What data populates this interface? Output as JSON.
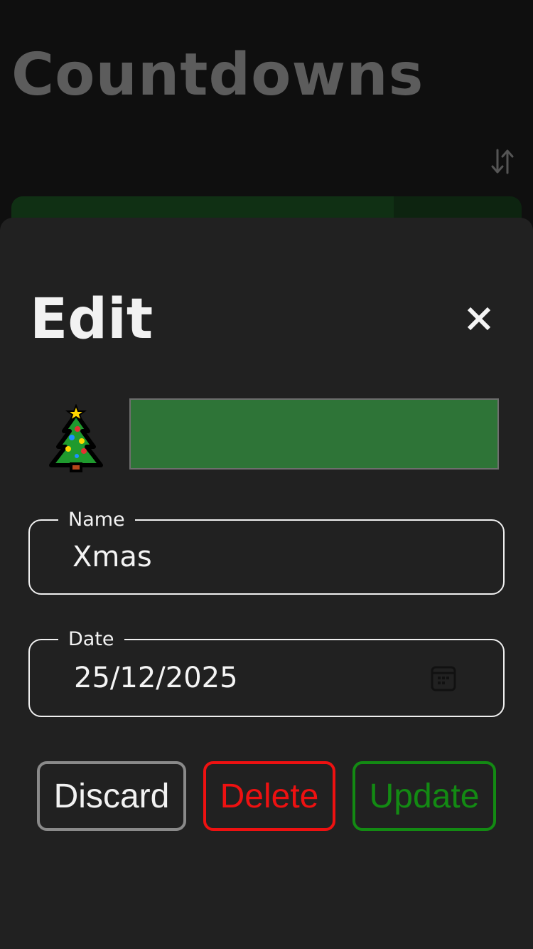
{
  "app": {
    "title": "Countdowns"
  },
  "background_card": {
    "color": "#0d2410"
  },
  "edit_sheet": {
    "title": "Edit",
    "emoji": "christmas-tree",
    "color_swatch": "#2e7437",
    "name_field": {
      "label": "Name",
      "value": "Xmas"
    },
    "date_field": {
      "label": "Date",
      "value": "25/12/2025"
    },
    "buttons": {
      "discard": "Discard",
      "delete": "Delete",
      "update": "Update"
    }
  },
  "colors": {
    "background": "#0f0f0f",
    "sheet": "#212121",
    "delete": "#ee1111",
    "update": "#138a13"
  }
}
